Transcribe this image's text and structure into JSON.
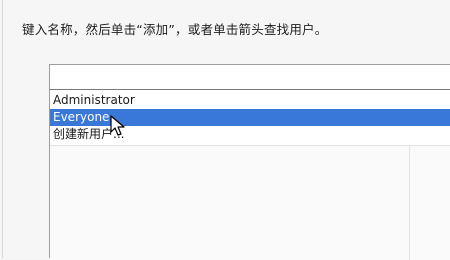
{
  "dialog": {
    "instruction": "键入名称，然后单击“添加”，或者单击箭头查找用户。"
  },
  "name_input": {
    "value": ""
  },
  "suggestions": {
    "items": [
      {
        "label": "Administrator",
        "selected": false
      },
      {
        "label": "Everyone",
        "selected": true
      },
      {
        "label": "创建新用户...",
        "selected": false
      }
    ]
  },
  "colors": {
    "selection": "#3a78d8",
    "list_background": "#ffffff",
    "window_background": "#f6f6f6"
  },
  "icons": {
    "pointer": "mouse-cursor-icon"
  }
}
